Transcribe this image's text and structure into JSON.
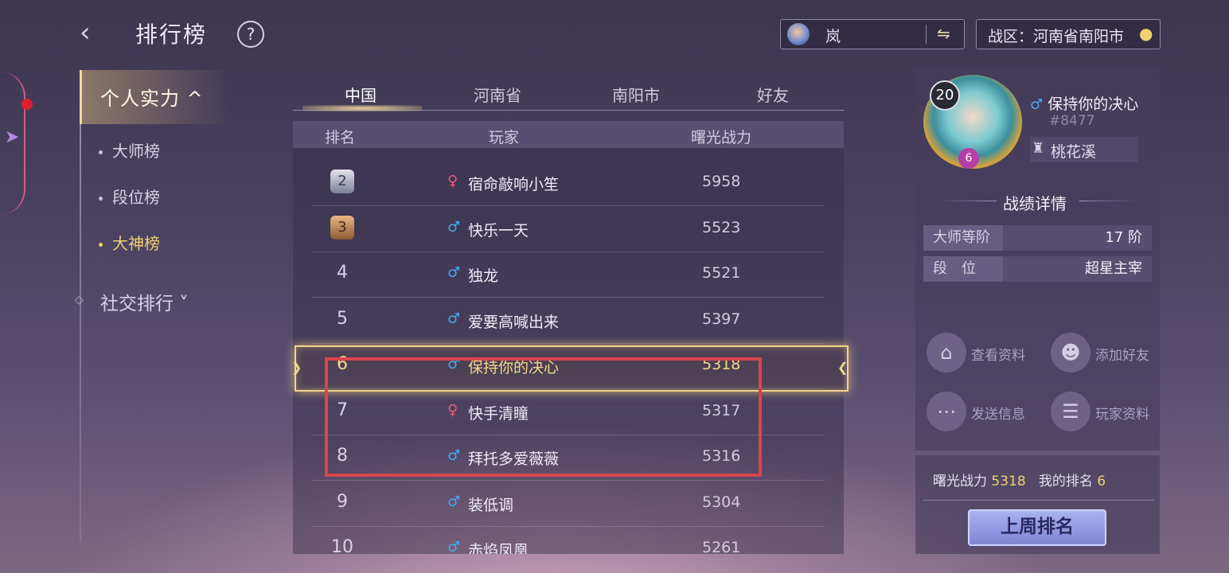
{
  "header": {
    "back_icon": "back-arrow-icon",
    "title": "排行榜",
    "help": "?",
    "hero_name": "岚",
    "swap_icon": "⇋",
    "region_label": "战区：河南省南阳市",
    "pin_icon": "location-pin-icon"
  },
  "menu": {
    "active": "个人实力 ^",
    "subs": [
      "大师榜",
      "段位榜",
      "大神榜"
    ],
    "social": "社交排行 ˅"
  },
  "tabs": [
    "中国",
    "河南省",
    "南阳市",
    "好友"
  ],
  "table": {
    "headers": [
      "排名",
      "玩家",
      "曙光战力"
    ],
    "rows": [
      {
        "rank": "2",
        "gender": "♀",
        "name": "宿命敲响小笙",
        "power": "5958"
      },
      {
        "rank": "3",
        "gender": "♂",
        "name": "快乐一天",
        "power": "5523"
      },
      {
        "rank": "4",
        "gender": "♂",
        "name": "独龙",
        "power": "5521"
      },
      {
        "rank": "5",
        "gender": "♂",
        "name": "爱要高喊出来",
        "power": "5397"
      },
      {
        "rank": "6",
        "gender": "♂",
        "name": "保持你的决心",
        "power": "5318"
      },
      {
        "rank": "7",
        "gender": "♀",
        "name": "快手清瞳",
        "power": "5317"
      },
      {
        "rank": "8",
        "gender": "♂",
        "name": "拜托多爱薇薇",
        "power": "5316"
      },
      {
        "rank": "9",
        "gender": "♂",
        "name": "装低调",
        "power": "5304"
      },
      {
        "rank": "10",
        "gender": "♂",
        "name": "赤焰凤凰",
        "power": "5261"
      }
    ]
  },
  "profile": {
    "level": "20",
    "star": "6",
    "gender": "♂",
    "name": "保持你的决心",
    "id": "#8477",
    "team": "桃花溪",
    "record_title": "战绩详情",
    "stats": [
      {
        "label": "大师等阶",
        "value": "17 阶"
      },
      {
        "label": "段　位",
        "value": "超星主宰"
      }
    ],
    "actions": [
      "查看资料",
      "添加好友",
      "发送信息",
      "玩家资料"
    ],
    "power_label": "曙光战力",
    "power_value": "5318",
    "rank_label": "我的排名",
    "rank_value": "6",
    "last_week_button": "上周排名"
  }
}
